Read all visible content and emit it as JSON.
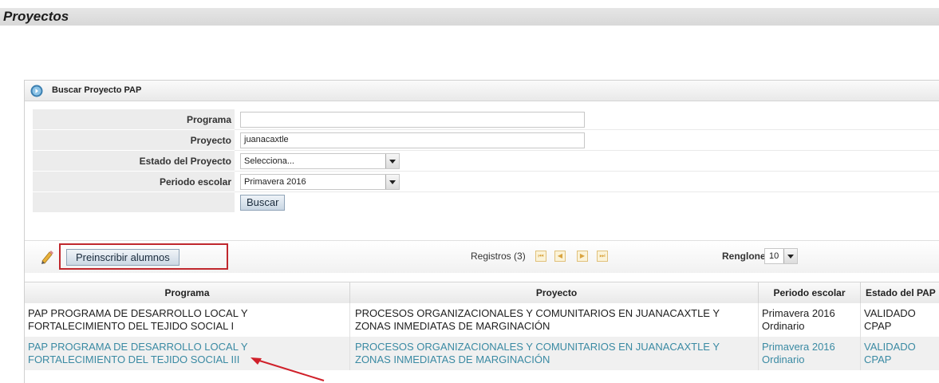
{
  "page": {
    "title": "Proyectos"
  },
  "panel": {
    "title": "Buscar Proyecto PAP"
  },
  "form": {
    "programa_label": "Programa",
    "programa_value": "",
    "proyecto_label": "Proyecto",
    "proyecto_value": "juanacaxtle",
    "estado_label": "Estado del Proyecto",
    "estado_value": "Selecciona...",
    "periodo_label": "Periodo escolar",
    "periodo_value": "Primavera 2016",
    "buscar_label": "Buscar"
  },
  "toolbar": {
    "preinscribir_label": "Preinscribir alumnos",
    "registros_text": "Registros (3)",
    "renglones_label": "Renglones",
    "renglones_value": "10"
  },
  "table": {
    "headers": [
      "Programa",
      "Proyecto",
      "Periodo escolar",
      "Estado del PAP"
    ],
    "rows": [
      {
        "programa": "PAP PROGRAMA DE DESARROLLO LOCAL Y FORTALECIMIENTO DEL TEJIDO SOCIAL I",
        "proyecto": "PROCESOS ORGANIZACIONALES Y COMUNITARIOS EN JUANACAXTLE Y ZONAS INMEDIATAS DE MARGINACIÓN",
        "periodo": "Primavera 2016 Ordinario",
        "estado": "VALIDADO CPAP"
      },
      {
        "programa": "PAP PROGRAMA DE DESARROLLO LOCAL Y FORTALECIMIENTO DEL TEJIDO SOCIAL III",
        "proyecto": "PROCESOS ORGANIZACIONALES Y COMUNITARIOS EN JUANACAXTLE Y ZONAS INMEDIATAS DE MARGINACIÓN",
        "periodo": "Primavera 2016 Ordinario",
        "estado": "VALIDADO CPAP"
      }
    ]
  },
  "colors": {
    "highlight": "#c0272d",
    "row_link": "#3a8aa3",
    "arrow": "#d0202a"
  },
  "icons": {
    "header": "circle-arrow-icon",
    "edit": "pencil-icon"
  }
}
